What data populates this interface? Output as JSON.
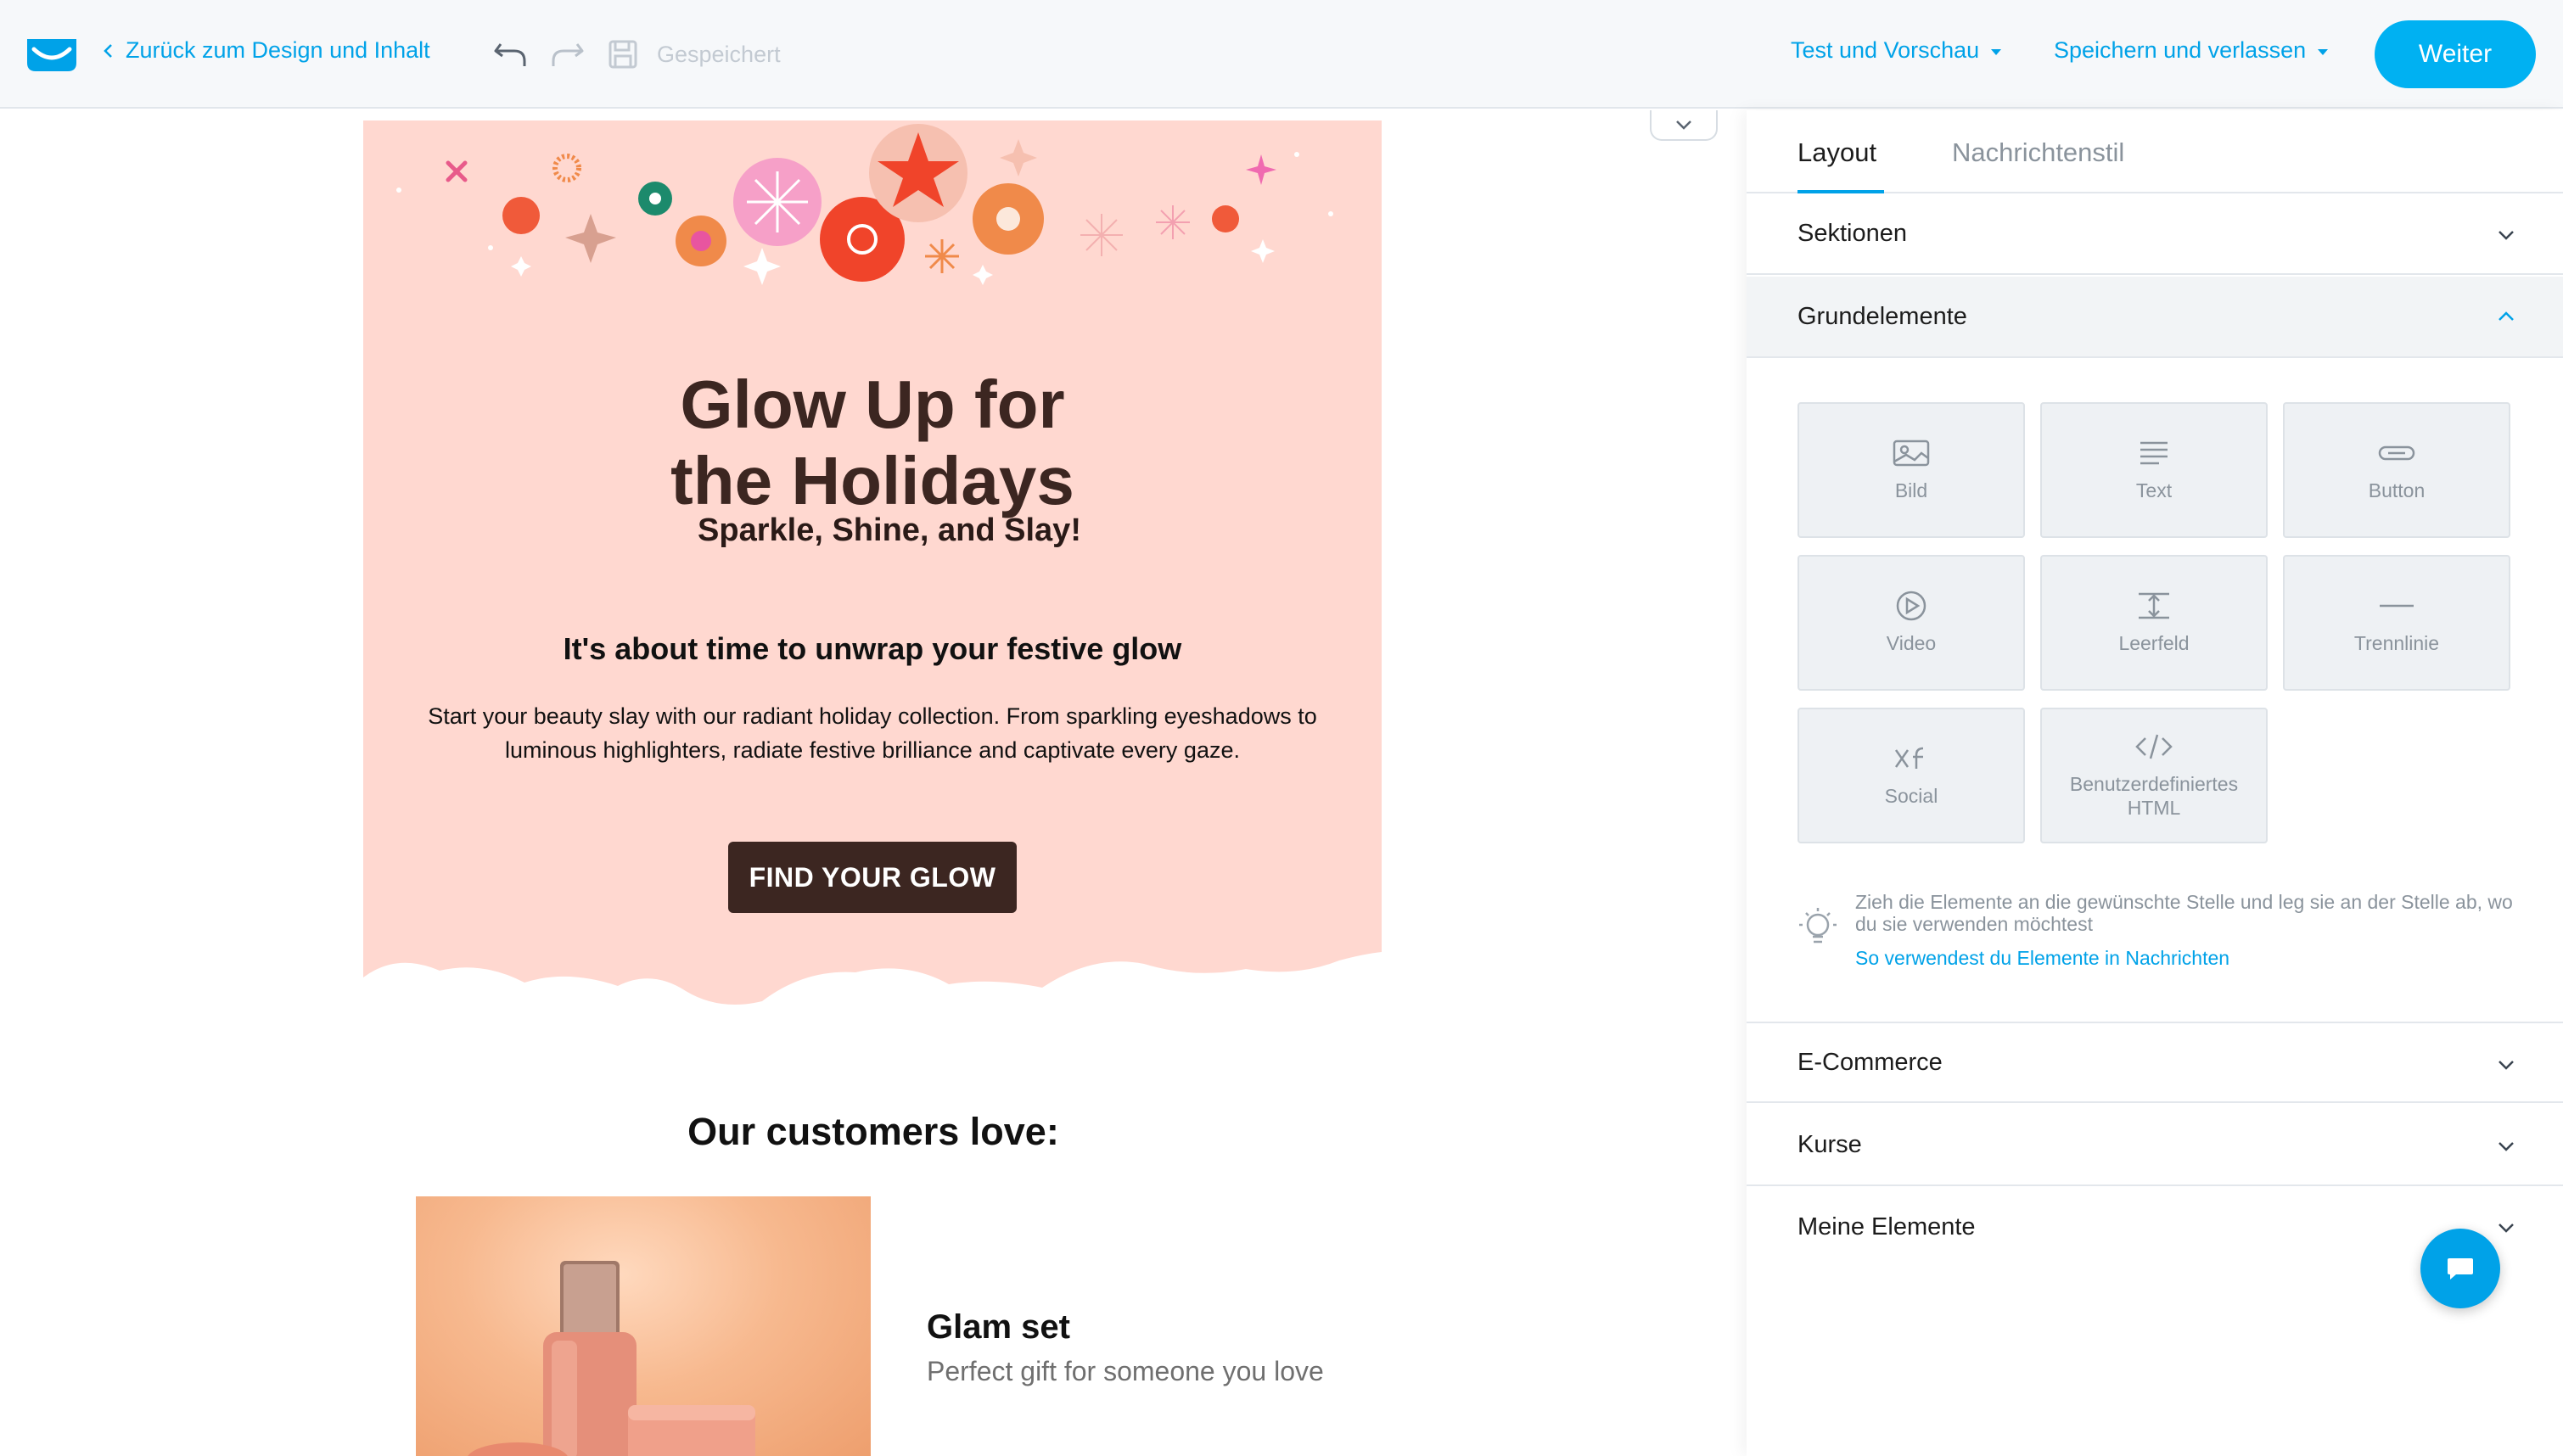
{
  "header": {
    "back_label": "Zurück zum Design und Inhalt",
    "saved_label": "Gespeichert",
    "test_preview_label": "Test und Vorschau",
    "save_exit_label": "Speichern und verlassen",
    "next_label": "Weiter"
  },
  "email": {
    "hero_title_line1": "Glow Up for",
    "hero_title_line2": "the Holidays",
    "hero_subtitle": "Sparkle, Shine, and Slay!",
    "hero_heading": "It's about time to unwrap your festive glow",
    "hero_body": "Start your beauty slay with our radiant holiday collection. From sparkling eyeshadows to luminous highlighters, radiate festive brilliance and captivate every gaze.",
    "cta_label": "FIND YOUR GLOW",
    "customers_title": "Our customers love:",
    "product_title": "Glam set",
    "product_desc": "Perfect gift for someone you love"
  },
  "panel": {
    "tabs": [
      "Layout",
      "Nachrichtenstil"
    ],
    "sections": {
      "sektionen": "Sektionen",
      "grundelemente": "Grundelemente",
      "ecommerce": "E-Commerce",
      "kurse": "Kurse",
      "meine": "Meine Elemente"
    },
    "tiles": [
      {
        "label": "Bild",
        "icon": "image-icon"
      },
      {
        "label": "Text",
        "icon": "text-icon"
      },
      {
        "label": "Button",
        "icon": "button-icon"
      },
      {
        "label": "Video",
        "icon": "video-icon"
      },
      {
        "label": "Leerfeld",
        "icon": "spacer-icon"
      },
      {
        "label": "Trennlinie",
        "icon": "divider-icon"
      },
      {
        "label": "Social",
        "icon": "social-icon"
      },
      {
        "label": "Benutzerdefiniertes HTML",
        "icon": "code-icon"
      }
    ],
    "hint_text": "Zieh die Elemente an die gewünschte Stelle und leg sie an der Stelle ab, wo du sie verwenden möchtest",
    "hint_link": "So verwendest du Elemente in Nachrichten"
  },
  "colors": {
    "accent": "#00a2e8",
    "hero_bg": "#ffd8d0",
    "cta_bg": "#3c2621"
  }
}
